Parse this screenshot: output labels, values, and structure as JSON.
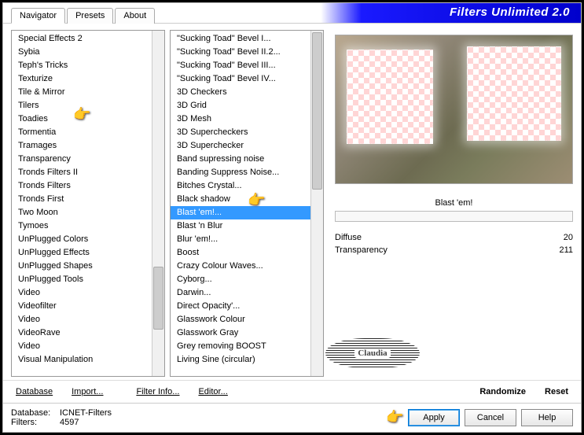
{
  "title": "Filters Unlimited 2.0",
  "tabs": [
    "Navigator",
    "Presets",
    "About"
  ],
  "activeTab": 0,
  "categories": [
    "Special Effects 2",
    "Sybia",
    "Teph's Tricks",
    "Texturize",
    "Tile & Mirror",
    "Tilers",
    "Toadies",
    "Tormentia",
    "Tramages",
    "Transparency",
    "Tronds Filters II",
    "Tronds Filters",
    "Tronds First",
    "Two Moon",
    "Tymoes",
    "UnPlugged Colors",
    "UnPlugged Effects",
    "UnPlugged Shapes",
    "UnPlugged Tools",
    "Video",
    "Videofilter",
    "Video",
    "VideoRave",
    "Video",
    "Visual Manipulation"
  ],
  "categoryPointerIndex": 6,
  "filters": [
    "\"Sucking Toad\"  Bevel I...",
    "\"Sucking Toad\"  Bevel II.2...",
    "\"Sucking Toad\"  Bevel III...",
    "\"Sucking Toad\"  Bevel IV...",
    "3D Checkers",
    "3D Grid",
    "3D Mesh",
    "3D Supercheckers",
    "3D Superchecker",
    "Band supressing noise",
    "Banding Suppress Noise...",
    "Bitches Crystal...",
    "Black shadow",
    "Blast 'em!...",
    "Blast 'n Blur",
    "Blur 'em!...",
    "Boost",
    "Crazy Colour Waves...",
    "Cyborg...",
    "Darwin...",
    "Direct Opacity'...",
    "Glasswork Colour",
    "Glasswork Gray",
    "Grey removing BOOST",
    "Living Sine (circular)"
  ],
  "selectedFilterIndex": 13,
  "buttons": {
    "database": "Database",
    "import": "Import...",
    "filterinfo": "Filter Info...",
    "editor": "Editor...",
    "randomize": "Randomize",
    "reset": "Reset"
  },
  "currentFilter": "Blast 'em!",
  "watermark": "Claudia",
  "params": [
    {
      "label": "Diffuse",
      "value": "20"
    },
    {
      "label": "Transparency",
      "value": "211"
    }
  ],
  "status": {
    "dbLabel": "Database:",
    "db": "ICNET-Filters",
    "filtLabel": "Filters:",
    "filt": "4597"
  },
  "footButtons": {
    "apply": "Apply",
    "cancel": "Cancel",
    "help": "Help"
  }
}
